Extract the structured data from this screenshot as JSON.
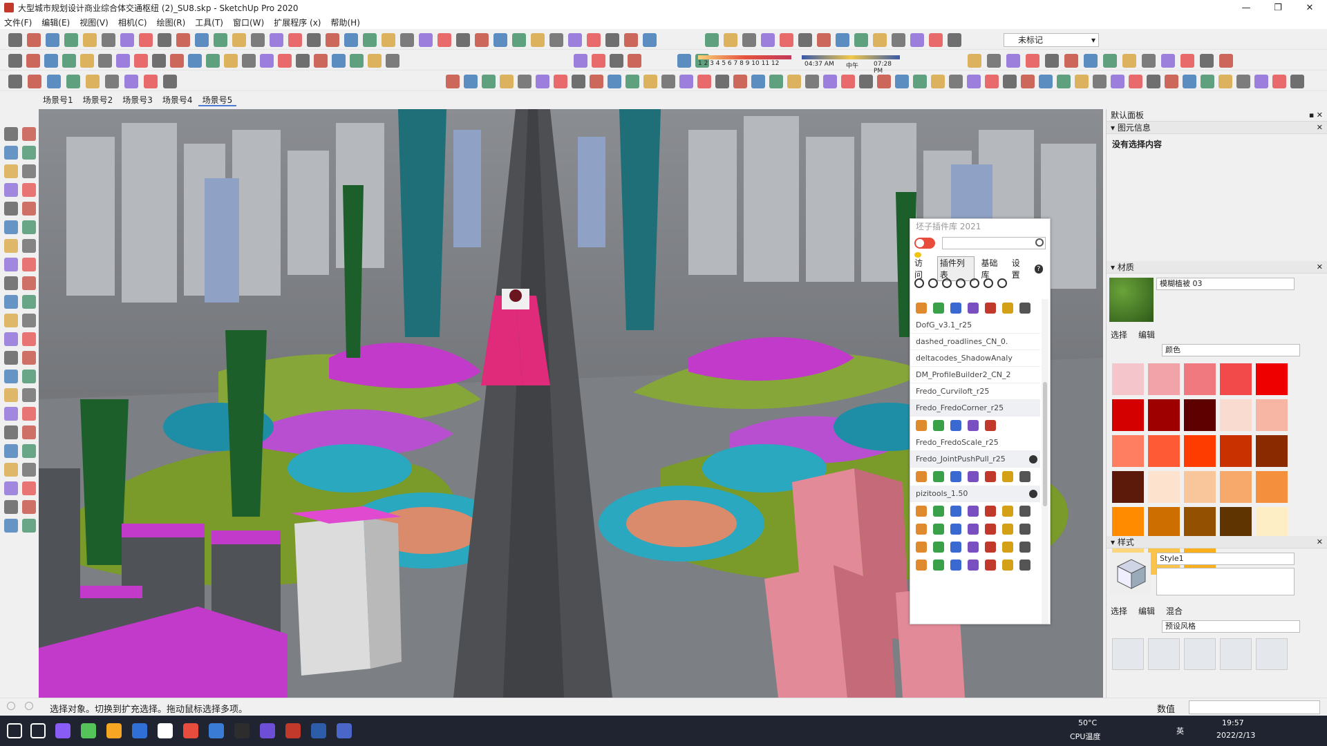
{
  "window": {
    "title": "大型城市规划设计商业综合体交通枢纽 (2)_SU8.skp - SketchUp Pro 2020",
    "minimize": "—",
    "maximize": "❐",
    "close": "✕"
  },
  "menu": [
    "文件(F)",
    "编辑(E)",
    "视图(V)",
    "相机(C)",
    "绘图(R)",
    "工具(T)",
    "窗口(W)",
    "扩展程序 (x)",
    "帮助(H)"
  ],
  "toolbar": {
    "tag_label": "未标记",
    "shadow_time_start": "04:37 AM",
    "shadow_time_noon": "中午",
    "shadow_time_end": "07:28 PM",
    "shadow_months": "1 2 3 4 5 6 7 8 9 10 11 12"
  },
  "scenes": [
    "场景号1",
    "场景号2",
    "场景号3",
    "场景号4",
    "场景号5"
  ],
  "plugin_panel": {
    "title": "坯子插件库 2021",
    "search_placeholder": "",
    "tabs": [
      "访问",
      "插件列表",
      "基础库",
      "设置"
    ],
    "help": "?",
    "items": [
      {
        "label": "DofG_v3.1_r25",
        "selected": false,
        "checked": false
      },
      {
        "label": "dashed_roadlines_CN_0.",
        "selected": false,
        "checked": false
      },
      {
        "label": "deltacodes_ShadowAnaly",
        "selected": false,
        "checked": false
      },
      {
        "label": "DM_ProfileBuilder2_CN_2",
        "selected": false,
        "checked": false
      },
      {
        "label": "Fredo_Curviloft_r25",
        "selected": false,
        "checked": false
      },
      {
        "label": "Fredo_FredoCorner_r25",
        "selected": true,
        "checked": false
      },
      {
        "label": "Fredo_FredoScale_r25",
        "selected": false,
        "checked": false
      },
      {
        "label": "Fredo_JointPushPull_r25",
        "selected": true,
        "checked": true
      },
      {
        "label": "pizitools_1.50",
        "selected": true,
        "checked": true
      }
    ]
  },
  "tray": {
    "title": "默认面板",
    "entity_info": {
      "header": "图元信息",
      "status": "没有选择内容"
    },
    "materials": {
      "header": "材质",
      "name": "模糊植被 03",
      "tab_select": "选择",
      "tab_edit": "编辑",
      "library": "颜色",
      "colors": [
        "#f4c6cc",
        "#f2a3a9",
        "#f0787f",
        "#f24a4a",
        "#ee0000",
        "#d40000",
        "#9e0000",
        "#5e0000",
        "#f9dccf",
        "#f6b6a3",
        "#ff7e62",
        "#ff5a36",
        "#ff3c00",
        "#c93200",
        "#8a2a00",
        "#5c1a0a",
        "#fde2cd",
        "#f9c59b",
        "#f7a96c",
        "#f48f3e",
        "#ff8c00",
        "#cc6f00",
        "#935000",
        "#603400",
        "#fdeec6",
        "#fbd67c",
        "#fac34a",
        "#f9b01c"
      ]
    },
    "styles": {
      "header": "样式",
      "name": "Style1",
      "tab_select": "选择",
      "tab_edit": "编辑",
      "tab_mix": "混合",
      "library": "预设风格"
    }
  },
  "status": {
    "hint": "选择对象。切换到扩充选择。拖动鼠标选择多项。",
    "measurements_label": "数值"
  },
  "taskbar": {
    "temp": "50°C",
    "temp_label": "CPU温度",
    "ime": "英",
    "time": "19:57",
    "date": "2022/2/13"
  }
}
